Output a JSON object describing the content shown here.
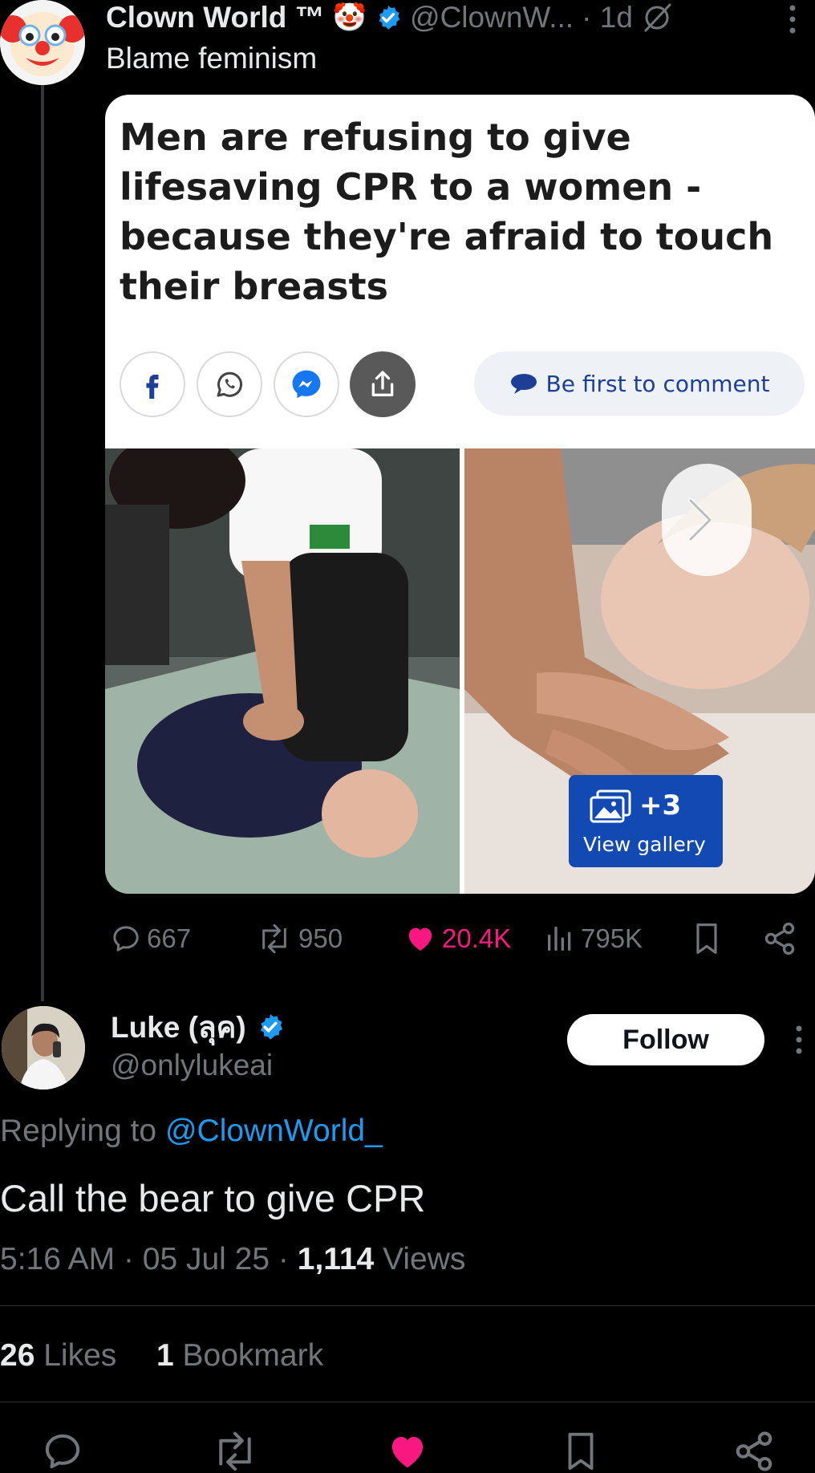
{
  "original_tweet": {
    "author_name": "Clown World ™",
    "author_emoji": "🤡",
    "handle": "@ClownW...",
    "time": "· 1d",
    "text": "Blame feminism",
    "card": {
      "headline": "Men are refusing to give lifesaving CPR to a women - because they're afraid to touch their breasts",
      "comment_label": "Be first to comment",
      "gallery_count": "+3",
      "gallery_label": "View gallery"
    },
    "actions": {
      "replies": "667",
      "reposts": "950",
      "likes": "20.4K",
      "views": "795K"
    }
  },
  "reply": {
    "author_name": "Luke (ลุค)",
    "handle": "@onlylukeai",
    "follow_label": "Follow",
    "replying_to_prefix": "Replying to",
    "replying_to_handle": "@ClownWorld_",
    "text": "Call the bear to give CPR",
    "time": "5:16 AM",
    "date": "05 Jul 25",
    "views_count": "1,114",
    "views_label": "Views",
    "likes_count": "26",
    "likes_label": "Likes",
    "bookmarks_count": "1",
    "bookmarks_label": "Bookmark"
  },
  "colors": {
    "background": "#000000",
    "verified": "#1d9bf0",
    "like": "#f91880",
    "muted": "#71767b",
    "gallery_button": "#1349b3"
  },
  "icons": [
    "verified-badge-icon",
    "mute-icon",
    "more-icon",
    "facebook-icon",
    "whatsapp-icon",
    "messenger-icon",
    "share-icon",
    "chat-bubble-icon",
    "gallery-icon",
    "chevron-right-icon",
    "reply-icon",
    "repost-icon",
    "heart-icon",
    "views-icon",
    "bookmark-icon"
  ]
}
